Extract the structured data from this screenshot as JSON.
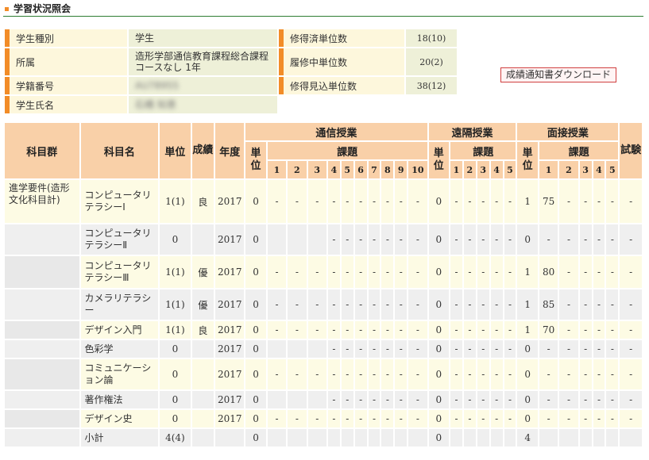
{
  "page_title": "学習状況照会",
  "student_info": {
    "type_label": "学生種別",
    "type_value": "学生",
    "dept_label": "所属",
    "dept_value": "造形学部通信教育課程総合課程コースなし 1年",
    "id_label": "学籍番号",
    "id_value": "AU78955",
    "name_label": "学生氏名",
    "name_value": "石橋 知恵",
    "earned_label": "修得済単位数",
    "earned_value": "18(10)",
    "taking_label": "履修中単位数",
    "taking_value": "20(2)",
    "expected_label": "修得見込単位数",
    "expected_value": "38(12)"
  },
  "download_button": "成績通知書ダウンロード",
  "table_headers": {
    "group": "科目群",
    "subject": "科目名",
    "units": "単位",
    "grade": "成績",
    "year": "年度",
    "correspondence": "通信授業",
    "remote": "遠隔授業",
    "schooling": "面接授業",
    "unit_sub": "単位",
    "assignments": "課題",
    "exam": "試験",
    "corr_nums": [
      "1",
      "2",
      "3",
      "4",
      "5",
      "6",
      "7",
      "8",
      "9",
      "10"
    ],
    "remote_nums": [
      "1",
      "2",
      "3",
      "4",
      "5"
    ],
    "school_nums": [
      "1",
      "2",
      "3",
      "4",
      "5"
    ]
  },
  "rows": [
    {
      "group": "進学要件(造形文化科目計)",
      "subject": "コンピュータリテラシーⅠ",
      "units": "1(1)",
      "grade": "良",
      "year": "2017",
      "c_unit": "0",
      "c": [
        "-",
        "-",
        "-",
        "-",
        "-",
        "-",
        "-",
        "-",
        "-",
        "-"
      ],
      "r_unit": "0",
      "r": [
        "-",
        "-",
        "-",
        "-",
        "-"
      ],
      "s_unit": "1",
      "s": [
        "75",
        "-",
        "-",
        "-",
        "-"
      ],
      "exam": "-"
    },
    {
      "group": "",
      "subject": "コンピュータリテラシーⅡ",
      "units": "0",
      "grade": "",
      "year": "2017",
      "c_unit": "0",
      "c": [
        "",
        "",
        "",
        "-",
        "-",
        "-",
        "-",
        "-",
        "-",
        "-"
      ],
      "r_unit": "0",
      "r": [
        "-",
        "-",
        "-",
        "-",
        "-"
      ],
      "s_unit": "0",
      "s": [
        "-",
        "-",
        "-",
        "-",
        "-"
      ],
      "exam": "-"
    },
    {
      "group": "",
      "subject": "コンピュータリテラシーⅢ",
      "units": "1(1)",
      "grade": "優",
      "year": "2017",
      "c_unit": "0",
      "c": [
        "-",
        "-",
        "-",
        "-",
        "-",
        "-",
        "-",
        "-",
        "-",
        "-"
      ],
      "r_unit": "0",
      "r": [
        "-",
        "-",
        "-",
        "-",
        "-"
      ],
      "s_unit": "1",
      "s": [
        "80",
        "-",
        "-",
        "-",
        "-"
      ],
      "exam": "-"
    },
    {
      "group": "",
      "subject": "カメラリテラシー",
      "units": "1(1)",
      "grade": "優",
      "year": "2017",
      "c_unit": "0",
      "c": [
        "-",
        "-",
        "-",
        "-",
        "-",
        "-",
        "-",
        "-",
        "-",
        "-"
      ],
      "r_unit": "0",
      "r": [
        "-",
        "-",
        "-",
        "-",
        "-"
      ],
      "s_unit": "1",
      "s": [
        "85",
        "-",
        "-",
        "-",
        "-"
      ],
      "exam": "-"
    },
    {
      "group": "",
      "subject": "デザイン入門",
      "units": "1(1)",
      "grade": "良",
      "year": "2017",
      "c_unit": "0",
      "c": [
        "-",
        "-",
        "-",
        "-",
        "-",
        "-",
        "-",
        "-",
        "-",
        "-"
      ],
      "r_unit": "0",
      "r": [
        "-",
        "-",
        "-",
        "-",
        "-"
      ],
      "s_unit": "1",
      "s": [
        "70",
        "-",
        "-",
        "-",
        "-"
      ],
      "exam": "-"
    },
    {
      "group": "",
      "subject": "色彩学",
      "units": "0",
      "grade": "",
      "year": "2017",
      "c_unit": "0",
      "c": [
        "",
        "",
        "",
        "-",
        "-",
        "-",
        "-",
        "-",
        "-",
        "-"
      ],
      "r_unit": "0",
      "r": [
        "-",
        "-",
        "-",
        "-",
        "-"
      ],
      "s_unit": "0",
      "s": [
        "-",
        "-",
        "-",
        "-",
        "-"
      ],
      "exam": "-"
    },
    {
      "group": "",
      "subject": "コミュニケーション論",
      "units": "0",
      "grade": "",
      "year": "2017",
      "c_unit": "0",
      "c": [
        "-",
        "-",
        "-",
        "-",
        "-",
        "-",
        "-",
        "-",
        "-",
        "-"
      ],
      "r_unit": "0",
      "r": [
        "-",
        "-",
        "-",
        "-",
        "-"
      ],
      "s_unit": "0",
      "s": [
        "-",
        "-",
        "-",
        "-",
        "-"
      ],
      "exam": "-"
    },
    {
      "group": "",
      "subject": "著作権法",
      "units": "0",
      "grade": "",
      "year": "2017",
      "c_unit": "0",
      "c": [
        "",
        "",
        "",
        "-",
        "-",
        "-",
        "-",
        "-",
        "-",
        "-"
      ],
      "r_unit": "0",
      "r": [
        "-",
        "-",
        "-",
        "-",
        "-"
      ],
      "s_unit": "0",
      "s": [
        "-",
        "-",
        "-",
        "-",
        "-"
      ],
      "exam": "-"
    },
    {
      "group": "",
      "subject": "デザイン史",
      "units": "0",
      "grade": "",
      "year": "2017",
      "c_unit": "0",
      "c": [
        "-",
        "-",
        "-",
        "-",
        "-",
        "-",
        "-",
        "-",
        "-",
        "-"
      ],
      "r_unit": "0",
      "r": [
        "-",
        "-",
        "-",
        "-",
        "-"
      ],
      "s_unit": "0",
      "s": [
        "-",
        "-",
        "-",
        "-",
        "-"
      ],
      "exam": "-"
    },
    {
      "group": "",
      "subject": "小計",
      "units": "4(4)",
      "grade": "",
      "year": "",
      "c_unit": "0",
      "c": [
        "",
        "",
        "",
        "",
        "",
        "",
        "",
        "",
        "",
        ""
      ],
      "r_unit": "0",
      "r": [
        "",
        "",
        "",
        "",
        ""
      ],
      "s_unit": "4",
      "s": [
        "",
        "",
        "",
        "",
        ""
      ],
      "exam": ""
    }
  ]
}
